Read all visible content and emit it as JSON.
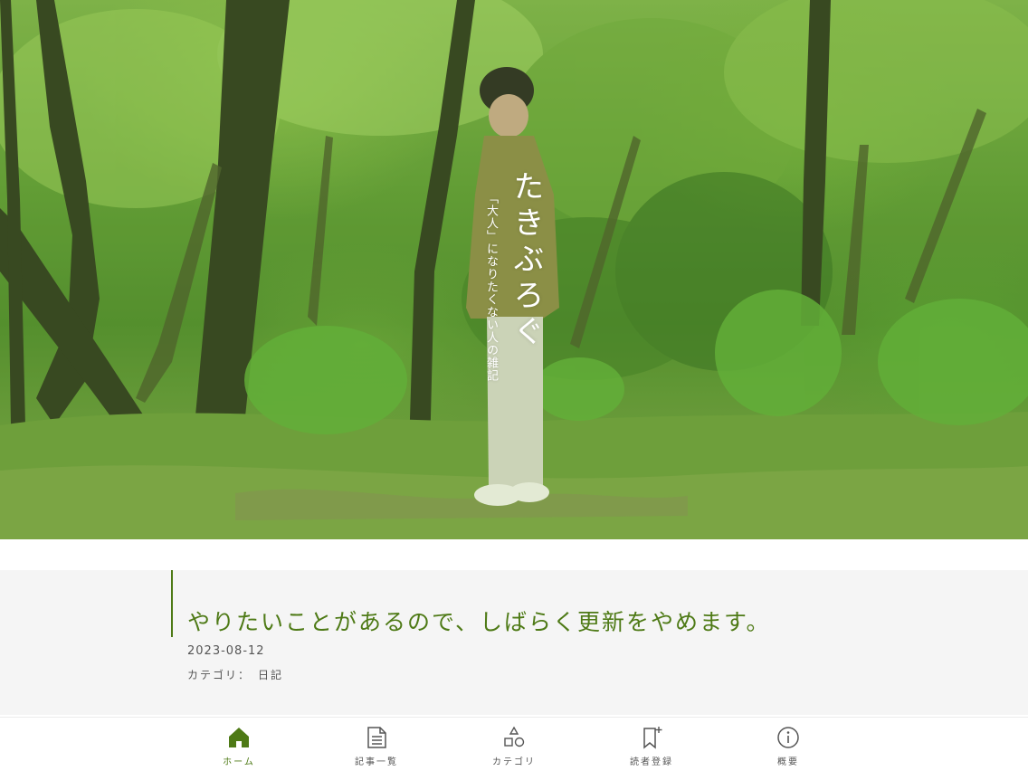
{
  "site": {
    "title": "たきぶろぐ",
    "tagline": "「大人」になりたくない人の雑記"
  },
  "article": {
    "title": "やりたいことがあるので、しばらく更新をやめます。",
    "date": "2023-08-12",
    "category_label": "カテゴリ：",
    "category": "日記"
  },
  "bottom_nav": {
    "items": [
      {
        "label": "ホーム",
        "icon": "home-icon",
        "active": true
      },
      {
        "label": "記事一覧",
        "icon": "document-list-icon",
        "active": false
      },
      {
        "label": "カテゴリ",
        "icon": "shapes-icon",
        "active": false
      },
      {
        "label": "読者登録",
        "icon": "bookmark-add-icon",
        "active": false
      },
      {
        "label": "概要",
        "icon": "info-icon",
        "active": false
      }
    ]
  },
  "colors": {
    "accent": "#4e7a16",
    "muted_text": "#555555",
    "card_background": "#f5f5f5"
  }
}
